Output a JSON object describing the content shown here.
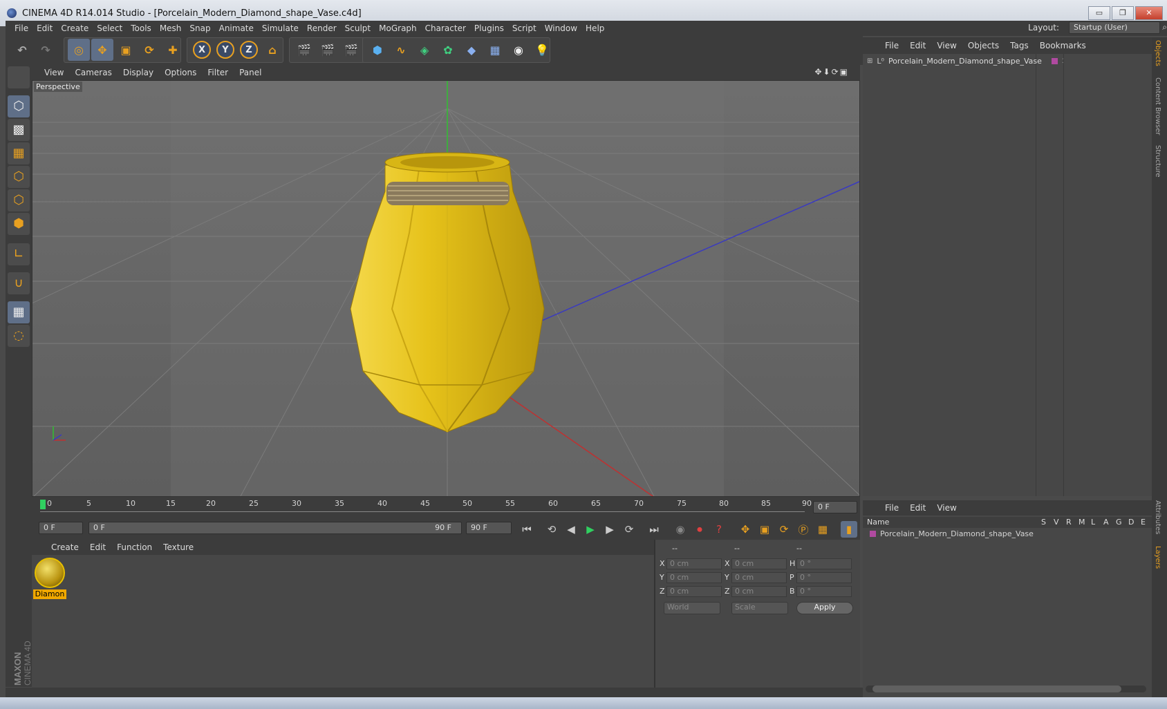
{
  "title": "CINEMA 4D R14.014 Studio - [Porcelain_Modern_Diamond_shape_Vase.c4d]",
  "window_buttons": {
    "minimize": "▭",
    "restore": "❐",
    "close": "✕"
  },
  "menu": [
    "File",
    "Edit",
    "Create",
    "Select",
    "Tools",
    "Mesh",
    "Snap",
    "Animate",
    "Simulate",
    "Render",
    "Sculpt",
    "MoGraph",
    "Character",
    "Plugins",
    "Script",
    "Window",
    "Help"
  ],
  "layout_label": "Layout:",
  "layout_value": "Startup (User)",
  "toolbar_axes": [
    "X",
    "Y",
    "Z"
  ],
  "viewport": {
    "menu": [
      "View",
      "Cameras",
      "Display",
      "Options",
      "Filter",
      "Panel"
    ],
    "label": "Perspective"
  },
  "timeline": {
    "ticks": [
      "0",
      "5",
      "10",
      "15",
      "20",
      "25",
      "30",
      "35",
      "40",
      "45",
      "50",
      "55",
      "60",
      "65",
      "70",
      "75",
      "80",
      "85",
      "90"
    ],
    "current_frame": "0 F",
    "start_field": "0 F",
    "slider_start": "0 F",
    "slider_end": "90 F",
    "end_field": "90 F"
  },
  "material": {
    "menu": [
      "Create",
      "Edit",
      "Function",
      "Texture"
    ],
    "name": "Diamon"
  },
  "coords": {
    "headers": [
      "--",
      "--",
      "--"
    ],
    "rows": [
      {
        "l1": "X",
        "v1": "0 cm",
        "l2": "X",
        "v2": "0 cm",
        "l3": "H",
        "v3": "0 °"
      },
      {
        "l1": "Y",
        "v1": "0 cm",
        "l2": "Y",
        "v2": "0 cm",
        "l3": "P",
        "v3": "0 °"
      },
      {
        "l1": "Z",
        "v1": "0 cm",
        "l2": "Z",
        "v2": "0 cm",
        "l3": "B",
        "v3": "0 °"
      }
    ],
    "world": "World",
    "scale": "Scale",
    "apply": "Apply"
  },
  "objects": {
    "menu": [
      "File",
      "Edit",
      "View",
      "Objects",
      "Tags",
      "Bookmarks"
    ],
    "item": "Porcelain_Modern_Diamond_shape_Vase"
  },
  "layers": {
    "menu": [
      "File",
      "Edit",
      "View"
    ],
    "name_header": "Name",
    "cols": [
      "S",
      "V",
      "R",
      "M",
      "L",
      "A",
      "G",
      "D",
      "E"
    ],
    "item": "Porcelain_Modern_Diamond_shape_Vase"
  },
  "right_tabs": [
    "Objects",
    "Content Browser",
    "Structure",
    "Attributes",
    "Layers"
  ],
  "brand": {
    "maxon": "MAXON",
    "cinema": "CINEMA 4D"
  },
  "colors": {
    "accent": "#e8a020",
    "vase": "#e6c21a",
    "selected": "#5f6f88"
  }
}
